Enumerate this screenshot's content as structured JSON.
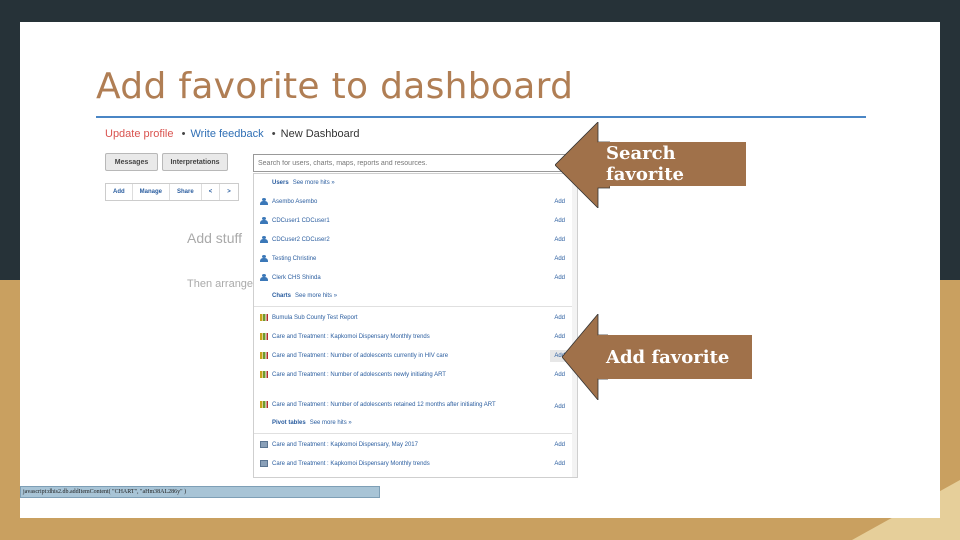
{
  "slide": {
    "title": "Add favorite to dashboard"
  },
  "topnav": {
    "update_profile": "Update profile",
    "sep": "•",
    "write_feedback": "Write feedback",
    "new_dashboard": "New Dashboard"
  },
  "tabs": {
    "messages": "Messages",
    "interpretations": "Interpretations"
  },
  "toolbar": {
    "add": "Add",
    "manage": "Manage",
    "share": "Share",
    "prev": "<",
    "next": ">"
  },
  "hints": {
    "line1": "Add stuff",
    "line2": "Then arrange"
  },
  "search": {
    "placeholder": "Search for users, charts, maps, reports and resources.",
    "value": ""
  },
  "dropdown": {
    "users_head": "Users",
    "users_more": "See more hits »",
    "users": [
      {
        "name": "Asembo Asembo",
        "action": "Add"
      },
      {
        "name": "CDCuser1 CDCuser1",
        "action": "Add"
      },
      {
        "name": "CDCuser2 CDCuser2",
        "action": "Add"
      },
      {
        "name": "Testing Christine",
        "action": "Add"
      },
      {
        "name": "Clerk CHS Shinda",
        "action": "Add"
      }
    ],
    "charts_head": "Charts",
    "charts_more": "See more hits »",
    "charts": [
      {
        "name": "Bumula Sub County Test Report",
        "action": "Add"
      },
      {
        "name": "Care and Treatment : Kapkomoi Dispensary Monthly trends",
        "action": "Add"
      },
      {
        "name": "Care and Treatment : Number of adolescents currently in HIV care",
        "action": "Add"
      },
      {
        "name": "Care and Treatment : Number of adolescents newly initiating ART",
        "action": "Add"
      },
      {
        "name": "Care and Treatment : Number of adolescents retained 12 months after initiating ART",
        "action": "Add"
      }
    ],
    "pivot_head": "Pivot tables",
    "pivot_more": "See more hits »",
    "pivots": [
      {
        "name": "Care and Treatment : Kapkomoi Dispensary, May 2017",
        "action": "Add"
      },
      {
        "name": "Care and Treatment : Kapkomoi Dispensary Monthly trends",
        "action": "Add"
      }
    ]
  },
  "callouts": {
    "search_favorite": "Search favorite",
    "add_favorite": "Add favorite"
  },
  "statusbar": {
    "text": "javascript:dhis2.db.addItemContent( \"CHART\", \"aHm38AL286y\" )"
  },
  "colors": {
    "title": "#b07e54",
    "callout": "#a0714a",
    "link": "#2a5d9f",
    "update_profile": "#d9534f",
    "rule": "#4a86c5"
  }
}
